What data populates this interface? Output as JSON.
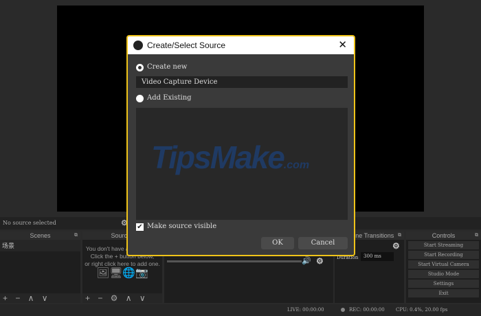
{
  "source_bar": {
    "text": "No source selected"
  },
  "scenes": {
    "title": "Scenes",
    "items": [
      "场景"
    ],
    "toolbar": "+ − ∧ ∨"
  },
  "sources": {
    "title": "Sources",
    "empty_lines": [
      "You don't have any sources.",
      "Click the + button below,",
      "or right click here to add one."
    ],
    "toolbar": "+ − ⚙ ∧ ∨"
  },
  "transitions": {
    "title": "Scene Transitions",
    "duration_label": "Duration",
    "duration_value": "300 ms"
  },
  "controls": {
    "title": "Controls",
    "buttons": [
      "Start Streaming",
      "Start Recording",
      "Start Virtual Camera",
      "Studio Mode",
      "Settings",
      "Exit"
    ]
  },
  "status": {
    "live": "LIVE: 00:00:00",
    "rec": "REC: 00:00:00",
    "cpu": "CPU: 0.4%, 20.00 fps"
  },
  "dialog": {
    "title": "Create/Select Source",
    "create_new": "Create new",
    "name_value": "Video Capture Device",
    "add_existing": "Add Existing",
    "make_visible": "Make source visible",
    "ok": "OK",
    "cancel": "Cancel",
    "watermark": "TipsMake",
    "watermark_suffix": ".com"
  }
}
